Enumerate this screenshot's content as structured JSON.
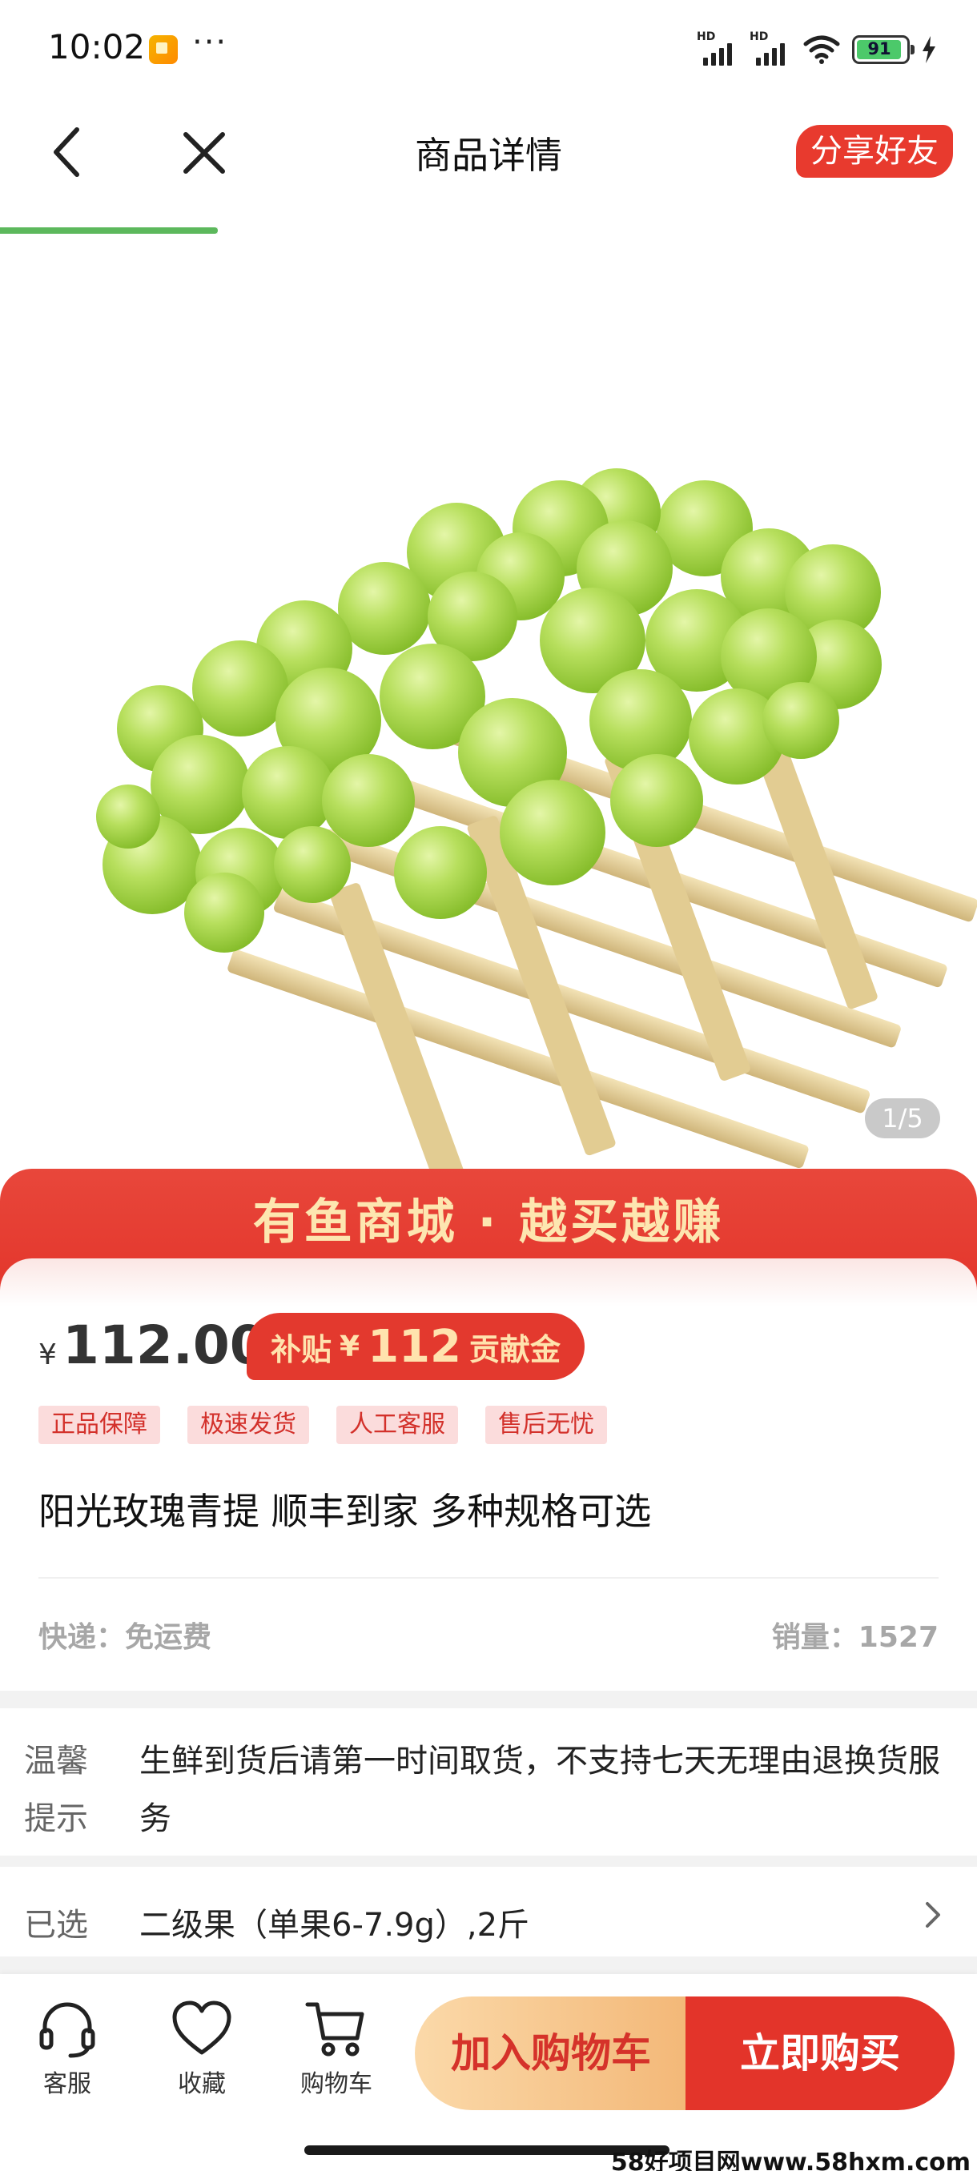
{
  "status_bar": {
    "time": "10:02",
    "dots": "···",
    "signal_1_badge": "HD",
    "signal_2_badge": "HD",
    "battery_level": "91"
  },
  "nav": {
    "title": "商品详情",
    "share_label": "分享好友"
  },
  "gallery": {
    "counter": "1/5"
  },
  "promo": {
    "banner_text": "有鱼商城 · 越买越赚"
  },
  "product": {
    "currency": "¥",
    "price": "112.00",
    "subsidy_prefix": "补贴",
    "subsidy_currency": "¥",
    "subsidy_amount": "112",
    "subsidy_suffix": "贡献金",
    "tags": [
      "正品保障",
      "极速发货",
      "人工客服",
      "售后无忧"
    ],
    "title": "阳光玫瑰青提 顺丰到家 多种规格可选",
    "shipping": "快递：免运费",
    "sales": "销量：1527"
  },
  "notice": {
    "label": "温馨提示",
    "text": "生鲜到货后请第一时间取货，不支持七天无理由退换货服务"
  },
  "selection": {
    "label": "已选",
    "value": "二级果（单果6-7.9g）,2斤"
  },
  "bottom_bar": {
    "service_label": "客服",
    "favorite_label": "收藏",
    "cart_label": "购物车",
    "add_to_cart": "加入购物车",
    "buy_now": "立即购买"
  },
  "watermark": "58好项目网www.58hxm.com",
  "colors": {
    "accent_red": "#e3342a",
    "progress_green": "#5cb85c",
    "promo_gold": "#fde6b0",
    "cart_button": "#f3b878"
  }
}
